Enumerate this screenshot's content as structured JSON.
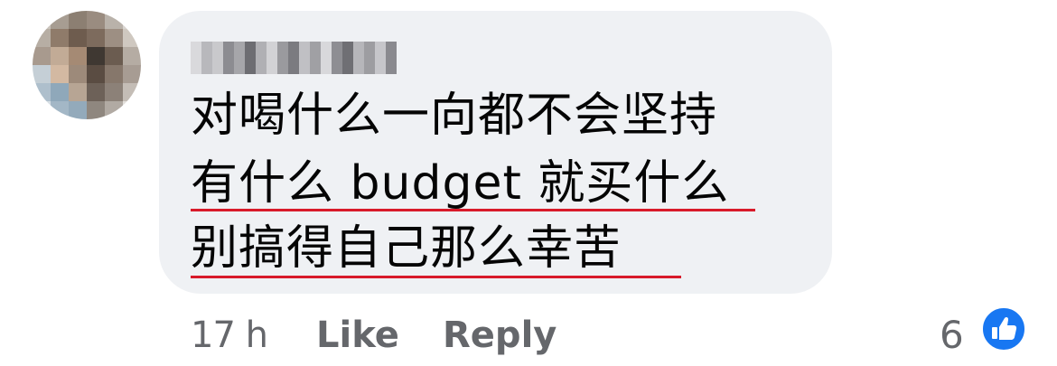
{
  "comment": {
    "lines": [
      "对喝什么一向都不会坚持",
      "有什么 budget 就买什么",
      "别搞得自己那么幸苦"
    ],
    "timestamp": "17 h",
    "like_label": "Like",
    "reply_label": "Reply",
    "reaction_count": "6",
    "reaction_icon": "thumbs-up-icon"
  },
  "colors": {
    "bubble": "#eff1f4",
    "text": "#050505",
    "muted": "#65676b",
    "underline": "#d81a2a",
    "like_blue": "#1877f2"
  }
}
